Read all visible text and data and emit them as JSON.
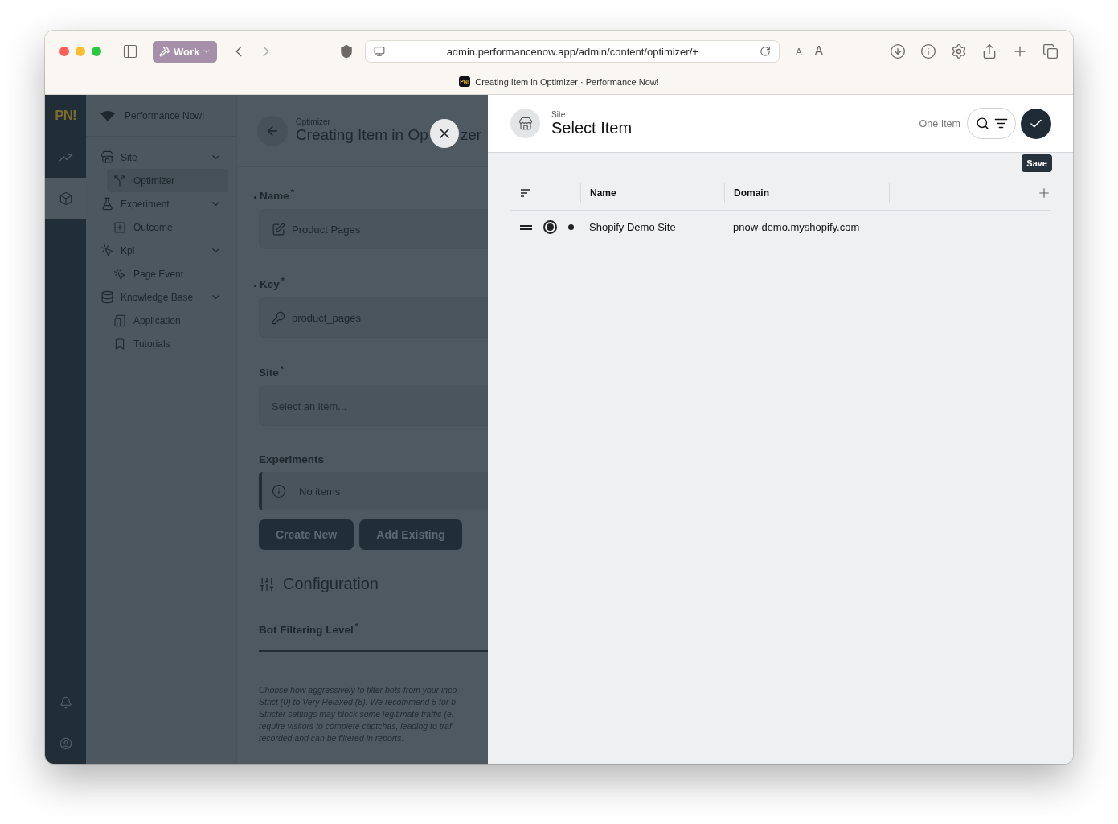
{
  "browser": {
    "workspace": "Work",
    "url": "admin.performancenow.app/admin/content/optimizer/+",
    "text_size_small": "A",
    "text_size_large": "A",
    "favicon": "PN!",
    "tab_title": "Creating Item in Optimizer · Performance Now!"
  },
  "rail": {
    "logo": "PN!",
    "items": [
      {
        "kind": "analytics",
        "selected": false
      },
      {
        "kind": "content",
        "selected": true
      }
    ],
    "footer": [
      {
        "kind": "notifications"
      },
      {
        "kind": "account"
      }
    ]
  },
  "sidebar": {
    "org": "Performance Now!",
    "groups": [
      {
        "label": "Site",
        "kind": "store",
        "expanded": true,
        "children": [
          {
            "label": "Optimizer",
            "kind": "split",
            "selected": true
          }
        ]
      },
      {
        "label": "Experiment",
        "kind": "flask",
        "expanded": true,
        "children": [
          {
            "label": "Outcome",
            "kind": "outcome",
            "selected": false
          }
        ]
      },
      {
        "label": "Kpi",
        "kind": "target",
        "expanded": true,
        "children": [
          {
            "label": "Page Event",
            "kind": "event",
            "selected": false
          }
        ]
      },
      {
        "label": "Knowledge Base",
        "kind": "database",
        "expanded": true,
        "children": [
          {
            "label": "Application",
            "kind": "app",
            "selected": false
          },
          {
            "label": "Tutorials",
            "kind": "bookmark",
            "selected": false
          }
        ]
      }
    ]
  },
  "form": {
    "eyebrow": "Optimizer",
    "title": "Creating Item in Op",
    "title_tail": "zer",
    "required_mark": "*",
    "fields": [
      {
        "label": "Name",
        "required": true,
        "modified": true,
        "kind": "text",
        "value": "Product Pages"
      },
      {
        "label": "Key",
        "required": true,
        "modified": true,
        "kind": "key",
        "value": "product_pages"
      },
      {
        "label": "Site",
        "required": true,
        "modified": false,
        "kind": "select",
        "placeholder": "Select an item..."
      }
    ],
    "experiments": {
      "label": "Experiments",
      "empty": "No items",
      "buttons": [
        "Create New",
        "Add Existing"
      ]
    },
    "configuration": {
      "title": "Configuration",
      "field": "Bot Filtering Level",
      "required": true,
      "help_lines": [
        "Choose how aggressively to filter bots from your inco",
        "Strict (0) to Very Relaxed (8). We recommend 5 for b",
        "Stricter settings may block some legitimate traffic (e.",
        "require visitors to complete captchas, leading to traf",
        "recorded and can be filtered in reports."
      ]
    }
  },
  "panel": {
    "eyebrow": "Site",
    "title": "Select Item",
    "count": "One Item",
    "tooltip": "Save",
    "columns": [
      "Name",
      "Domain"
    ],
    "rows": [
      {
        "selected": true,
        "cells": [
          "Shopify Demo Site",
          "pnow-demo.myshopify.com"
        ]
      }
    ]
  }
}
